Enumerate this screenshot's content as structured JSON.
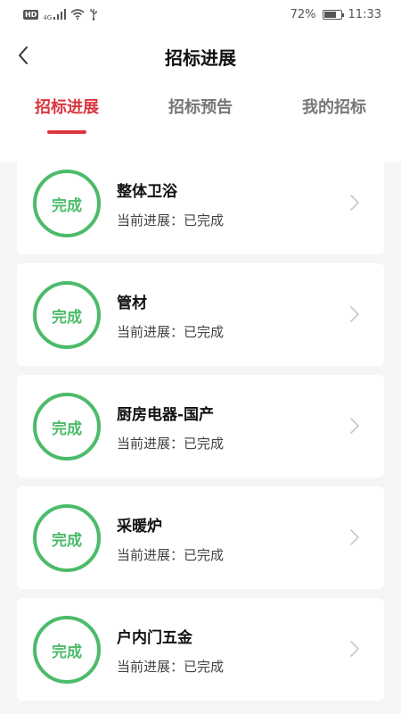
{
  "status_bar": {
    "left_badge": "HD",
    "network_label": "4G",
    "battery_percent": "72%",
    "battery_level": 0.72,
    "time": "11:33",
    "icons": [
      "signal-icon",
      "wifi-icon",
      "usb-icon",
      "battery-icon"
    ]
  },
  "header": {
    "title": "招标进展",
    "back_icon": "chevron-left-icon"
  },
  "tabs": [
    {
      "label": "招标进展",
      "active": true
    },
    {
      "label": "招标预告",
      "active": false
    },
    {
      "label": "我的招标",
      "active": false
    }
  ],
  "colors": {
    "accent": "#d9363e",
    "complete_green": "#4cbb6a",
    "background": "#f5f5f5"
  },
  "items": [
    {
      "status": "完成",
      "title": "整体卫浴",
      "progress": "当前进展：已完成"
    },
    {
      "status": "完成",
      "title": "管材",
      "progress": "当前进展：已完成"
    },
    {
      "status": "完成",
      "title": "厨房电器-国产",
      "progress": "当前进展：已完成"
    },
    {
      "status": "完成",
      "title": "采暖炉",
      "progress": "当前进展：已完成"
    },
    {
      "status": "完成",
      "title": "户内门五金",
      "progress": "当前进展：已完成"
    }
  ]
}
